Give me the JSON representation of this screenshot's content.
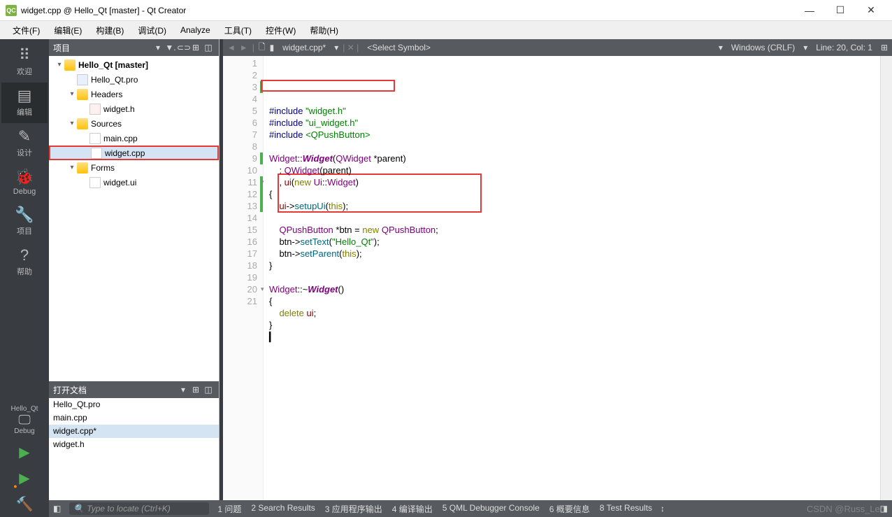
{
  "titlebar": {
    "app_icon": "QC",
    "title": "widget.cpp @ Hello_Qt [master] - Qt Creator"
  },
  "menus": [
    "文件(F)",
    "编辑(E)",
    "构建(B)",
    "调试(D)",
    "Analyze",
    "工具(T)",
    "控件(W)",
    "帮助(H)"
  ],
  "iconbar": {
    "items": [
      {
        "label": "欢迎",
        "glyph": "⠿"
      },
      {
        "label": "编辑",
        "glyph": "▤"
      },
      {
        "label": "设计",
        "glyph": "✎"
      },
      {
        "label": "Debug",
        "glyph": "🐞"
      },
      {
        "label": "项目",
        "glyph": "🔧"
      },
      {
        "label": "帮助",
        "glyph": "?"
      }
    ],
    "kit_name": "Hello_Qt",
    "kit_mode": "Debug"
  },
  "project_panel": {
    "title": "项目",
    "tree": [
      {
        "level": 0,
        "arrow": "▾",
        "icon": "folder",
        "label": "Hello_Qt [master]",
        "bold": true
      },
      {
        "level": 1,
        "arrow": "",
        "icon": "pro",
        "label": "Hello_Qt.pro"
      },
      {
        "level": 1,
        "arrow": "▾",
        "icon": "folder",
        "label": "Headers"
      },
      {
        "level": 2,
        "arrow": "",
        "icon": "hfile",
        "label": "widget.h"
      },
      {
        "level": 1,
        "arrow": "▾",
        "icon": "folder",
        "label": "Sources"
      },
      {
        "level": 2,
        "arrow": "",
        "icon": "file",
        "label": "main.cpp"
      },
      {
        "level": 2,
        "arrow": "",
        "icon": "file",
        "label": "widget.cpp",
        "selected": true,
        "highlight": true
      },
      {
        "level": 1,
        "arrow": "▾",
        "icon": "folder",
        "label": "Forms"
      },
      {
        "level": 2,
        "arrow": "",
        "icon": "file",
        "label": "widget.ui"
      }
    ],
    "opendocs_title": "打开文档",
    "opendocs": [
      {
        "label": "Hello_Qt.pro"
      },
      {
        "label": "main.cpp"
      },
      {
        "label": "widget.cpp*",
        "selected": true
      },
      {
        "label": "widget.h"
      }
    ]
  },
  "editor_toolbar": {
    "file": "widget.cpp*",
    "symbol": "<Select Symbol>",
    "encoding": "Windows (CRLF)",
    "position": "Line: 20, Col: 1"
  },
  "code_lines": [
    {
      "n": 1,
      "html": "<span class='pp'>#include</span> <span class='str'>\"widget.h\"</span>"
    },
    {
      "n": 2,
      "html": "<span class='pp'>#include</span> <span class='str'>\"ui_widget.h\"</span>"
    },
    {
      "n": 3,
      "html": "<span class='pp'>#include</span> <span class='str'>&lt;QPushButton&gt;</span>",
      "mark": true
    },
    {
      "n": 4,
      "html": ""
    },
    {
      "n": 5,
      "html": "<span class='type'>Widget</span>::<span class='ital'>Widget</span>(<span class='type'>QWidget</span> *parent)"
    },
    {
      "n": 6,
      "html": "    : <span class='type'>QWidget</span>(parent)"
    },
    {
      "n": 7,
      "html": "    , <span class='id'>ui</span>(<span class='kw'>new</span> <span class='type'>Ui</span>::<span class='type'>Widget</span>)",
      "fold": true
    },
    {
      "n": 8,
      "html": "{"
    },
    {
      "n": 9,
      "html": "    <span class='id'>ui</span>-><span class='fn'>setupUi</span>(<span class='kw'>this</span>);",
      "mark": true
    },
    {
      "n": 10,
      "html": ""
    },
    {
      "n": 11,
      "html": "    <span class='type'>QPushButton</span> *btn = <span class='kw'>new</span> <span class='type'>QPushButton</span>;",
      "mark": true
    },
    {
      "n": 12,
      "html": "    btn-><span class='fn'>setText</span>(<span class='str'>\"Hello_Qt\"</span>);",
      "mark": true
    },
    {
      "n": 13,
      "html": "    btn-><span class='fn'>setParent</span>(<span class='kw'>this</span>);",
      "mark": true
    },
    {
      "n": 14,
      "html": "}"
    },
    {
      "n": 15,
      "html": ""
    },
    {
      "n": 16,
      "html": "<span class='type'>Widget</span>::~<span class='ital'>Widget</span>()",
      "fold": true
    },
    {
      "n": 17,
      "html": "{"
    },
    {
      "n": 18,
      "html": "    <span class='kw'>delete</span> <span class='id'>ui</span>;"
    },
    {
      "n": 19,
      "html": "}"
    },
    {
      "n": 20,
      "html": "▎"
    },
    {
      "n": 21,
      "html": ""
    }
  ],
  "statusbar": {
    "locator_placeholder": "Type to locate (Ctrl+K)",
    "tabs": [
      "1 问题",
      "2 Search Results",
      "3 应用程序输出",
      "4 编译输出",
      "5 QML Debugger Console",
      "6 概要信息",
      "8 Test Results"
    ]
  },
  "watermark": "CSDN @Russ_Leo"
}
